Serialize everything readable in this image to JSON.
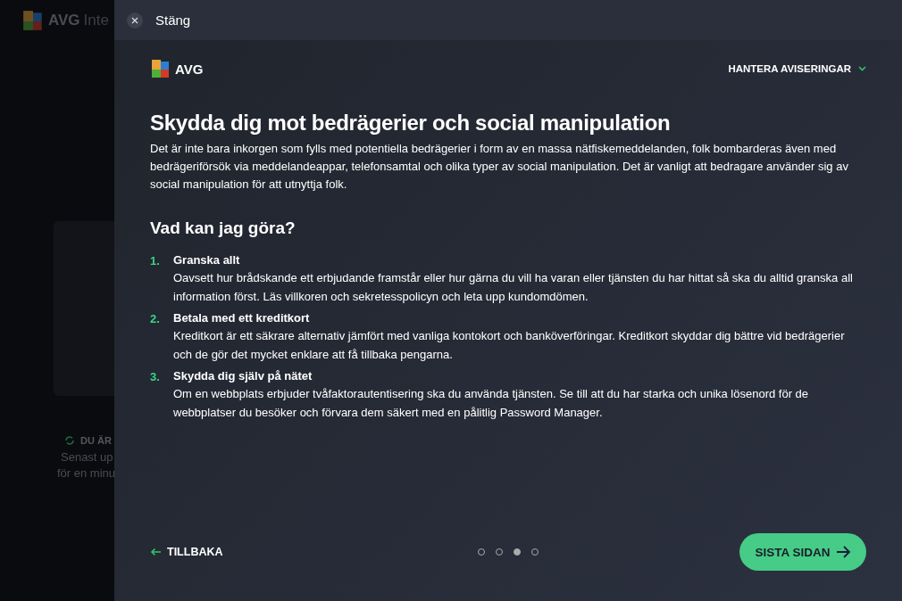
{
  "background_app": {
    "logo_text": "AVG",
    "title": "Inte",
    "status": "DU ÄR",
    "updated_lines": [
      "Senast up",
      "för en minu"
    ]
  },
  "panel": {
    "close_label": "Stäng",
    "logo_text": "AVG",
    "menu": "HANTERA AVISERINGAR",
    "heading": "Skydda dig mot bedrägerier och social manipulation",
    "intro": "Det är inte bara inkorgen som fylls med potentiella bedrägerier i form av en massa nätfiskemeddelanden, folk bombarderas även med bedrägeriförsök via meddelandeappar, telefonsamtal och olika typer av social manipulation. Det är vanligt att bedragare använder sig av social manipulation för att utnyttja folk.",
    "subheading": "Vad kan jag göra?",
    "tips": [
      {
        "number": "1.",
        "title": "Granska allt",
        "text": "Oavsett hur brådskande ett erbjudande framstår eller hur gärna du vill ha varan eller tjänsten du har hittat så ska du alltid granska all information först. Läs villkoren och sekretesspolicyn och leta upp kundomdömen."
      },
      {
        "number": "2.",
        "title": "Betala med ett kreditkort",
        "text": "Kreditkort är ett säkrare alternativ jämfört med vanliga kontokort och banköverföringar. Kreditkort skyddar dig bättre vid bedrägerier och de gör det mycket enklare att få tillbaka pengarna."
      },
      {
        "number": "3.",
        "title": "Skydda dig själv på nätet",
        "text": "Om en webbplats erbjuder tvåfaktorautentisering ska du använda tjänsten. Se till att du har starka och unika lösenord för de webbplatser du besöker och förvara dem säkert med en pålitlig Password Manager."
      }
    ],
    "back_label": "TILLBAKA",
    "pages": [
      {
        "selected": false
      },
      {
        "selected": false
      },
      {
        "selected": true
      },
      {
        "selected": false
      }
    ],
    "next_label": "SISTA SIDAN"
  }
}
